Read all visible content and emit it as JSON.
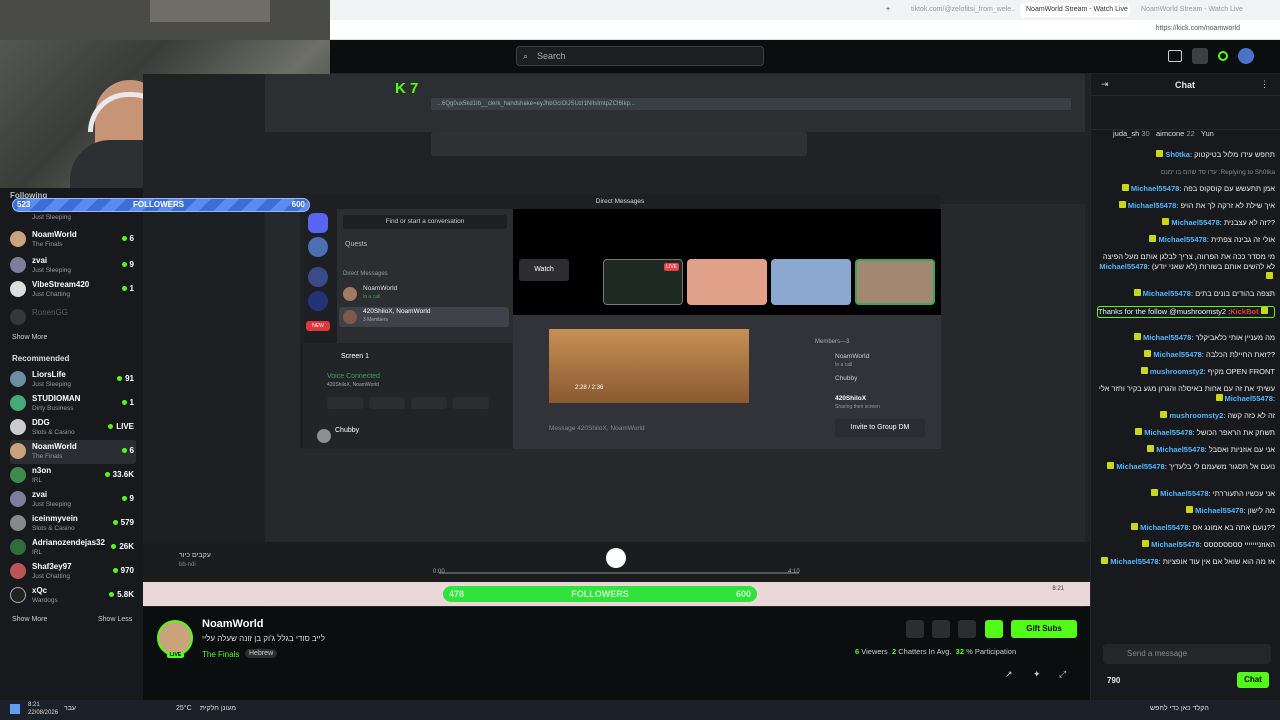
{
  "browser": {
    "tabs": [
      {
        "label": "tiktok.com/@zelofitsi_from_wele..."
      },
      {
        "label": "NoamWorld Stream - Watch Live"
      },
      {
        "label": "NoamWorld Stream - Watch Live"
      }
    ],
    "url": "https://kick.com/noamworld",
    "inner_url": "...6Qg0ux5kd1Ib__clerk_handshake=eyJhbGciOiJSUzI1NiIsImtpZCI6Ikp..."
  },
  "header": {
    "search_placeholder": "Search"
  },
  "overlay": {
    "followers_label": "FOLLOWERS",
    "followers_current": "523",
    "followers_goal": "600",
    "bottom_followers_current": "478",
    "bottom_followers_goal": "600",
    "k7": "K 7"
  },
  "sidebar": {
    "following_title": "Following",
    "following": [
      {
        "name": "Just Sleeping",
        "sub": "",
        "viewers": ""
      },
      {
        "name": "NoamWorld",
        "sub": "The Finals",
        "viewers": "6"
      },
      {
        "name": "zvai",
        "sub": "Just Sleeping",
        "viewers": "9"
      },
      {
        "name": "VibeStream420",
        "sub": "Just Chatting",
        "viewers": "1"
      },
      {
        "name": "RonenGG",
        "sub": "",
        "viewers": ""
      }
    ],
    "show_more": "Show More",
    "recommended_title": "Recommended",
    "recommended": [
      {
        "name": "LiorsLife",
        "sub": "Just Sleeping",
        "viewers": "91"
      },
      {
        "name": "STUDIOMAN",
        "sub": "Dirty Business",
        "viewers": "1"
      },
      {
        "name": "DDG",
        "sub": "Slots & Casino",
        "viewers": "LIVE"
      },
      {
        "name": "NoamWorld",
        "sub": "The Finals",
        "viewers": "6"
      },
      {
        "name": "n3on",
        "sub": "IRL",
        "viewers": "33.6K"
      },
      {
        "name": "zvai",
        "sub": "Just Sleeping",
        "viewers": "9"
      },
      {
        "name": "iceinmyvein",
        "sub": "Slots & Casino",
        "viewers": "579"
      },
      {
        "name": "Adrianozendejas32",
        "sub": "IRL",
        "viewers": "26K"
      },
      {
        "name": "Shaf3ey97",
        "sub": "Just Chatting",
        "viewers": "970"
      },
      {
        "name": "xQc",
        "sub": "Wardogs",
        "viewers": "5.8K"
      }
    ],
    "show_more2": "Show More",
    "show_less": "Show Less"
  },
  "discord": {
    "title": "Direct Messages",
    "find": "Find or start a conversation",
    "quests": "Quests",
    "dm_header": "Direct Messages",
    "dms": [
      {
        "name": "NoamWorld",
        "sub": "In a call"
      },
      {
        "name": "420ShiloX, NoamWorld",
        "sub": "3 Members"
      }
    ],
    "screen": "Screen 1",
    "voice": "Voice Connected",
    "voice_sub": "420ShiloX, NoamWorld",
    "user": "Chubby",
    "watch": "Watch",
    "live": "LIVE",
    "members_title": "Members—3",
    "members": [
      {
        "name": "NoamWorld",
        "sub": "In a call"
      },
      {
        "name": "Chubby",
        "sub": ""
      },
      {
        "name": "420ShiloX",
        "sub": "Sharing their screen"
      }
    ],
    "video_time": "2:28 / 2:36",
    "message_placeholder": "Message 420ShiloX, NoamWorld",
    "invite": "Invite to Group DM"
  },
  "player": {
    "time_start": "0:00",
    "time_end": "4:10",
    "song_title": "עקבים כיור",
    "song_artist": "bb-ndi"
  },
  "stream_info": {
    "channel": "NoamWorld",
    "title": "לייב סודי בגלל ג'וק בן זונה שעלה עליי",
    "category": "The Finals",
    "tag": "Hebrew",
    "live": "LIVE",
    "viewers_count": "6",
    "viewers_label": "Viewers",
    "chatters_count": "2",
    "chatters_label": "Chatters In Avg.",
    "participation": "32",
    "participation_label": "% Participation",
    "gift_subs": "Gift Subs"
  },
  "chat": {
    "title": "Chat",
    "top_gifters": [
      {
        "name": "juda_sh",
        "count": "30"
      },
      {
        "name": "aimcone",
        "count": "22"
      },
      {
        "name": "Yun",
        "count": ""
      }
    ],
    "messages": [
      {
        "user": "Sh0tka",
        "text": "תחפש עידו מלול בטיקטוק"
      },
      {
        "user": "",
        "text": "Replying to Sh0tka: עדו סד שהם בו ימנם"
      },
      {
        "user": "Michael55478",
        "text": "אמן תתעשש עם קוסקוס בפה"
      },
      {
        "user": "Michael55478",
        "text": "איך שילת לא זרקה לך את הויפ"
      },
      {
        "user": "Michael55478",
        "text": "??זה לא עצבנית"
      },
      {
        "user": "Michael55478",
        "text": "אולי זה גבינה צפתית"
      },
      {
        "user": "Michael55478",
        "text": "מי מסדר ככה את הפרווה, צריך לבלגן אותם מעל הפיצה לא להשים אותם בשורות (לא שאני יודע)"
      },
      {
        "user": "Michael55478",
        "text": "תצפה בהודים בונים בתים"
      },
      {
        "user": "KickBot",
        "text": "Thanks for the follow @mushroomsty2"
      },
      {
        "user": "Michael55478",
        "text": "מה מעניין אותי כלאביקלר"
      },
      {
        "user": "Michael55478",
        "text": "??זאת החיילת הכלבה"
      },
      {
        "user": "mushroomsty2",
        "text": "OPEN FRONT מקיף"
      },
      {
        "user": "Michael55478",
        "text": "עשיתי את זה עם אחות באיסלה והגרון מגע בקיר וחזר אלי"
      },
      {
        "user": "mushroomsty2",
        "text": "זה לא כזה קשה"
      },
      {
        "user": "Michael55478",
        "text": "תשחק את הראפר הכושל"
      },
      {
        "user": "Michael55478",
        "text": "אני עם אוזניות ואסבל"
      },
      {
        "user": "Michael55478",
        "text": "נועם אל תסגור משעמם לי בלעדיך"
      },
      {
        "user": "Michael55478",
        "text": "אני עכשיו התעוררתי"
      },
      {
        "user": "Michael55478",
        "text": "מה לישון"
      },
      {
        "user": "Michael55478",
        "text": "??נועם אתה בא אמונג אס"
      },
      {
        "user": "Michael55478",
        "text": "האוזנייייייי סססססססס"
      },
      {
        "user": "Michael55478",
        "text": "אז מה הוא שואל אם אין עוד אופציות"
      }
    ],
    "send_placeholder": "Send a message",
    "points": "790",
    "chat_button": "Chat"
  },
  "taskbar": {
    "weather": "25°C",
    "weather_text": "מעונן חלקית",
    "lang": "עבר",
    "time": "8:21",
    "date": "22/08/2026",
    "search_text": "הקלד כאן כדי לחפש"
  },
  "colors": {
    "kick_green": "#53fc18",
    "chat_user": "#53b6fc",
    "follower_blue": "#3b6fd6"
  }
}
